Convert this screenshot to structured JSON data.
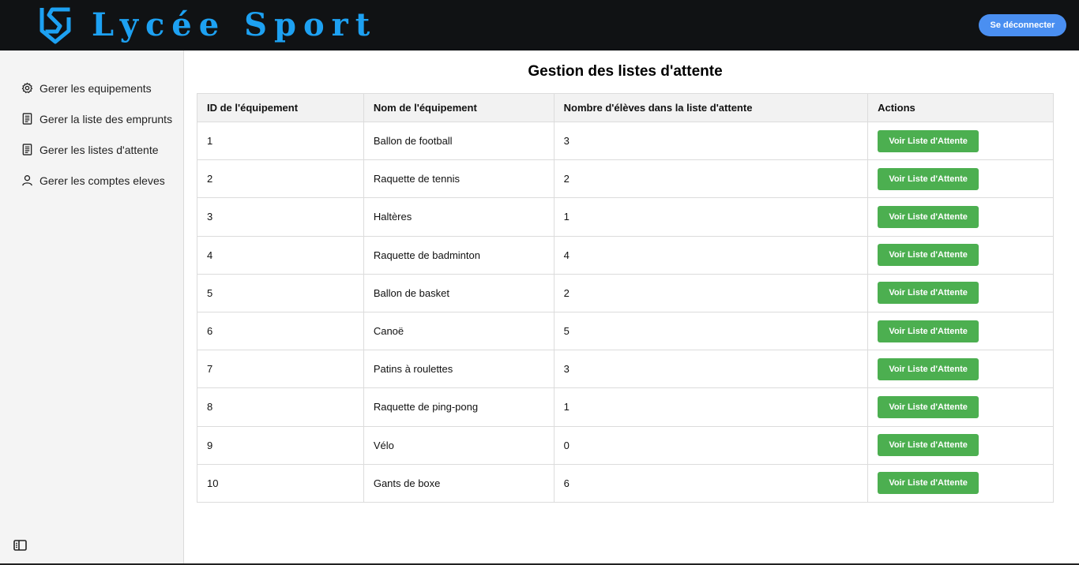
{
  "header": {
    "brand_name": "Lycée Sport",
    "logo_icon": "shield-s-logo",
    "logout_label": "Se déconnecter",
    "colors": {
      "bar": "#101214",
      "brand": "#1da1f2",
      "logout": "#4a8ff1"
    }
  },
  "sidebar": {
    "items": [
      {
        "label": "Gerer les equipements",
        "icon": "gear-icon"
      },
      {
        "label": "Gerer la liste des emprunts",
        "icon": "list-document-icon"
      },
      {
        "label": "Gerer les listes d'attente",
        "icon": "list-document-icon"
      },
      {
        "label": "Gerer les comptes eleves",
        "icon": "user-icon"
      }
    ],
    "toggle_icon": "sidebar-toggle-icon"
  },
  "main": {
    "title": "Gestion des listes d'attente",
    "table": {
      "headers": [
        "ID de l'équipement",
        "Nom de l'équipement",
        "Nombre d'élèves dans la liste d'attente",
        "Actions"
      ],
      "action_label": "Voir Liste d'Attente",
      "action_color": "#4caf50",
      "rows": [
        {
          "id": "1",
          "name": "Ballon de football",
          "count": "3"
        },
        {
          "id": "2",
          "name": "Raquette de tennis",
          "count": "2"
        },
        {
          "id": "3",
          "name": "Haltères",
          "count": "1"
        },
        {
          "id": "4",
          "name": "Raquette de badminton",
          "count": "4"
        },
        {
          "id": "5",
          "name": "Ballon de basket",
          "count": "2"
        },
        {
          "id": "6",
          "name": "Canoë",
          "count": "5"
        },
        {
          "id": "7",
          "name": "Patins à roulettes",
          "count": "3"
        },
        {
          "id": "8",
          "name": "Raquette de ping-pong",
          "count": "1"
        },
        {
          "id": "9",
          "name": "Vélo",
          "count": "0"
        },
        {
          "id": "10",
          "name": "Gants de boxe",
          "count": "6"
        }
      ]
    }
  }
}
